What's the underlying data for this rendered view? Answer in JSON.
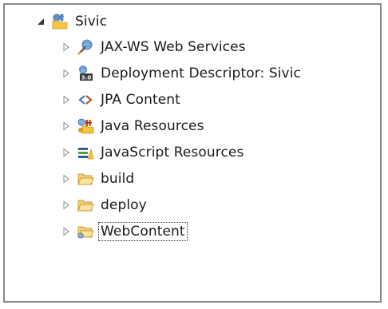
{
  "tree": {
    "root": {
      "label": "Sivic",
      "icon": "web-project-icon",
      "expanded": true
    },
    "children": [
      {
        "label": "JAX-WS Web Services",
        "icon": "jaxws-services-icon"
      },
      {
        "label": "Deployment Descriptor: Sivic",
        "icon": "deployment-descriptor-icon"
      },
      {
        "label": "JPA Content",
        "icon": "jpa-content-icon"
      },
      {
        "label": "Java Resources",
        "icon": "java-resources-icon"
      },
      {
        "label": "JavaScript Resources",
        "icon": "javascript-resources-icon"
      },
      {
        "label": "build",
        "icon": "folder-icon"
      },
      {
        "label": "deploy",
        "icon": "folder-icon"
      },
      {
        "label": "WebContent",
        "icon": "web-content-folder-icon",
        "focused": true
      }
    ]
  },
  "colors": {
    "frame_border": "#8a8a8a",
    "folder": "#f5c542",
    "folder_dark": "#c9962a",
    "arrow": "#9a9a9a",
    "expanded_arrow": "#3a3a3a"
  }
}
